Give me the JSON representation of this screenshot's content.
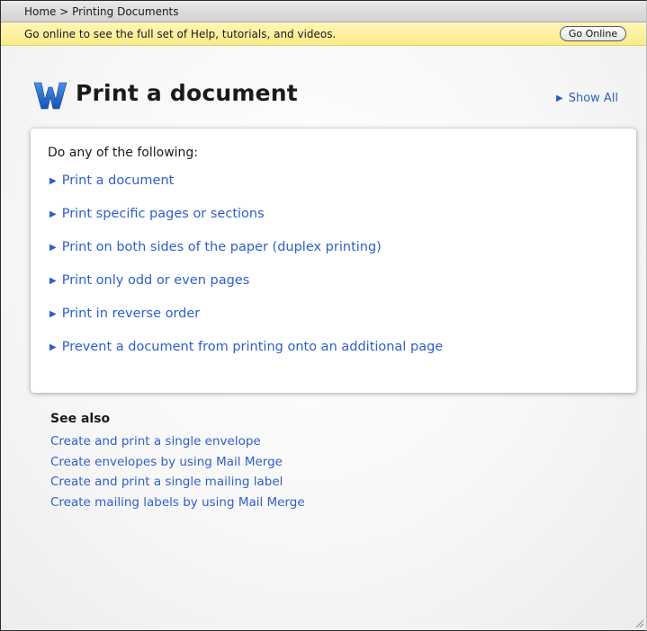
{
  "breadcrumb": "Home > Printing Documents",
  "online_bar": {
    "message": "Go online to see the full set of Help, tutorials, and videos.",
    "button_label": "Go Online"
  },
  "header": {
    "logo_icon": "word-logo-icon",
    "title": "Print a document",
    "show_all_label": "Show All"
  },
  "card": {
    "heading": "Do any of the following:",
    "items": [
      "Print a document",
      "Print specific pages or sections",
      "Print on both sides of the paper (duplex printing)",
      "Print only odd or even pages",
      "Print in reverse order",
      "Prevent a document from printing onto an additional page"
    ]
  },
  "see_also": {
    "title": "See also",
    "links": [
      "Create and print a single envelope",
      "Create envelopes by using Mail Merge",
      "Create and print a single mailing label",
      "Create mailing labels by using Mail Merge"
    ]
  },
  "colors": {
    "link": "#2e5fc9",
    "info_bar": "#f8ea8a",
    "logo_blue": "#1e66c8"
  }
}
